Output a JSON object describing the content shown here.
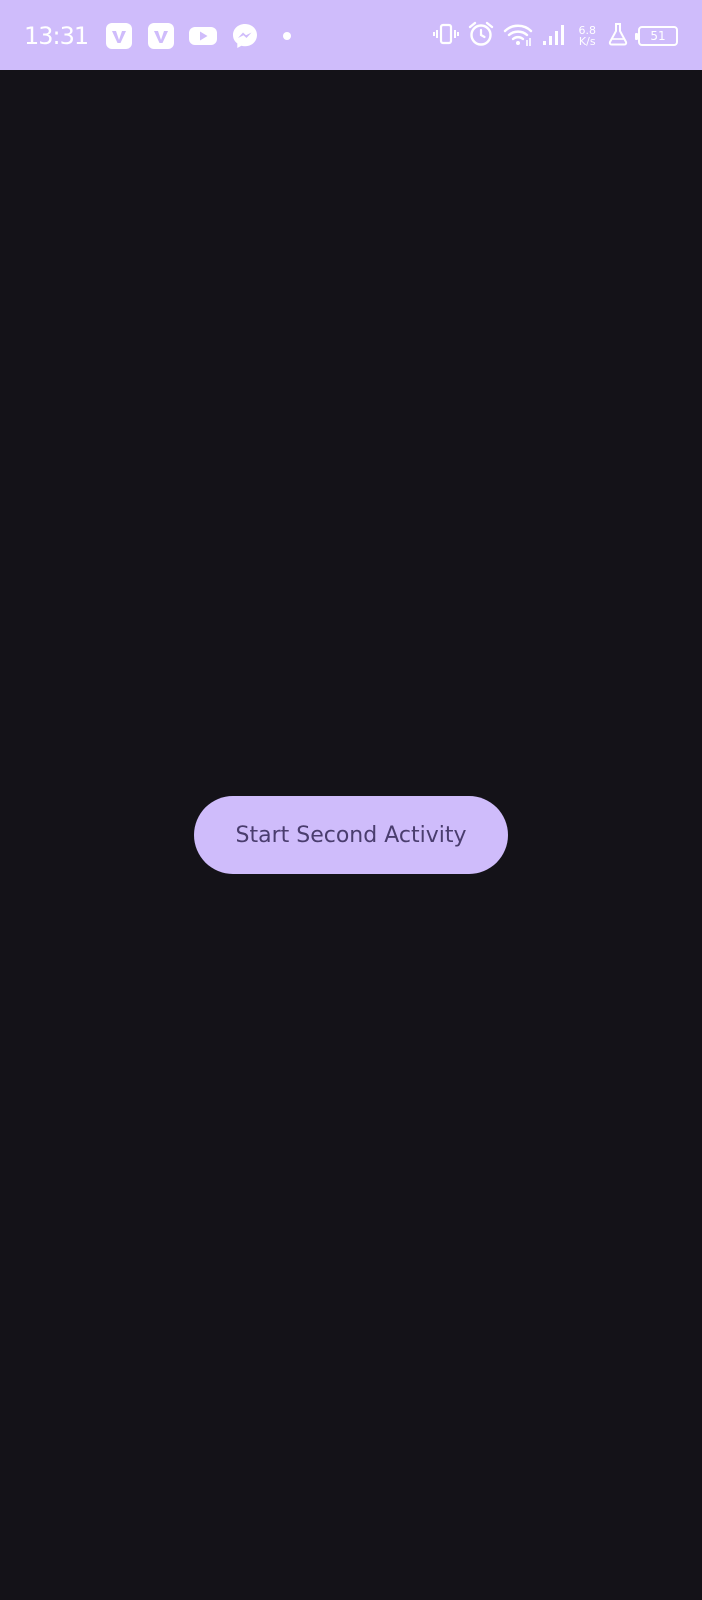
{
  "status_bar": {
    "time": "13:31",
    "left_icons": [
      "vimeo-icon",
      "vimeo-icon",
      "youtube-icon",
      "messenger-icon",
      "notification-dot-icon"
    ],
    "right_icons": [
      "vibrate-icon",
      "alarm-icon",
      "wifi-icon",
      "signal-icon",
      "flask-icon"
    ],
    "net_speed_value": "6.8",
    "net_speed_unit": "K/s",
    "battery_level": "51",
    "background_color": "#cfbcfb"
  },
  "main": {
    "background_color": "#141218",
    "start_button_label": "Start Second Activity",
    "button_color": "#cfbcfb",
    "button_text_color": "#4a3d6e"
  }
}
